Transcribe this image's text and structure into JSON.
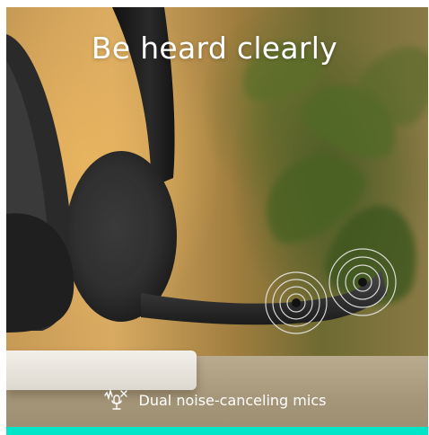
{
  "headline": "Be heard clearly",
  "feature": {
    "label": "Dual noise-canceling mics",
    "icon": "noise-canceling-mic-icon"
  },
  "colors": {
    "accent_bar": "#00e4c8",
    "text": "#ffffff"
  }
}
